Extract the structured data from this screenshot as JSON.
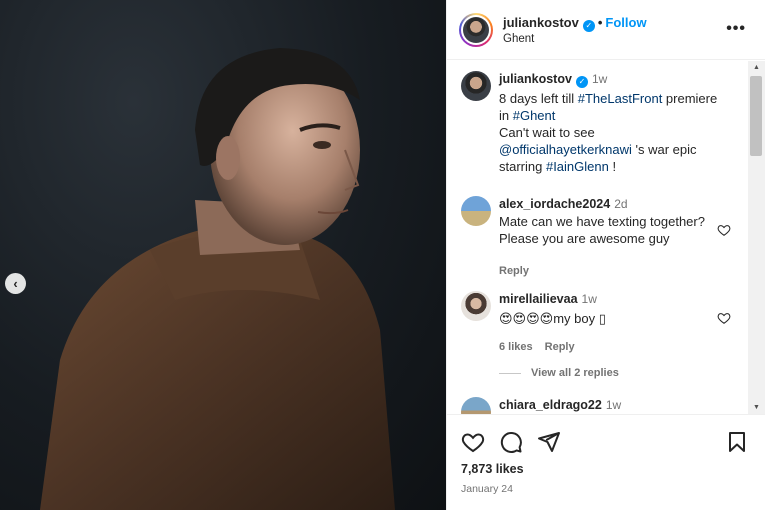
{
  "post": {
    "username": "juliankostov",
    "follow_label": "Follow",
    "separator": "•",
    "location": "Ghent",
    "more_label": "•••",
    "prev_label": "‹"
  },
  "caption": {
    "username": "juliankostov",
    "time": "1w",
    "line1_a": "8 days left till ",
    "hashtag1": "#TheLastFront",
    "line1_b": " premiere",
    "line2_a": "in ",
    "hashtag2": "#Ghent",
    "line3": "Can't wait to see",
    "mention": "@officialhayetkerknawi",
    "line4_b": " 's war epic",
    "line5_a": "starring ",
    "hashtag3": "#IainGlenn",
    "line5_b": " !"
  },
  "comments": [
    {
      "username": "alex_iordache2024",
      "time": "2d",
      "text_line1": "Mate can we have texting together?",
      "text_line2": "Please you are awesome guy",
      "reply_label": "Reply"
    },
    {
      "username": "mirellailievaa",
      "time": "1w",
      "text": "😍😍😍😍my boy ▯",
      "likes_label": "6 likes",
      "reply_label": "Reply",
      "view_replies": "View all 2 replies"
    },
    {
      "username": "chiara_eldrago22",
      "time": "1w"
    }
  ],
  "footer": {
    "likes": "7,873 likes",
    "date": "January 24"
  },
  "colors": {
    "link_blue": "#0095f6",
    "tag_blue": "#00376b",
    "muted": "#737373"
  }
}
